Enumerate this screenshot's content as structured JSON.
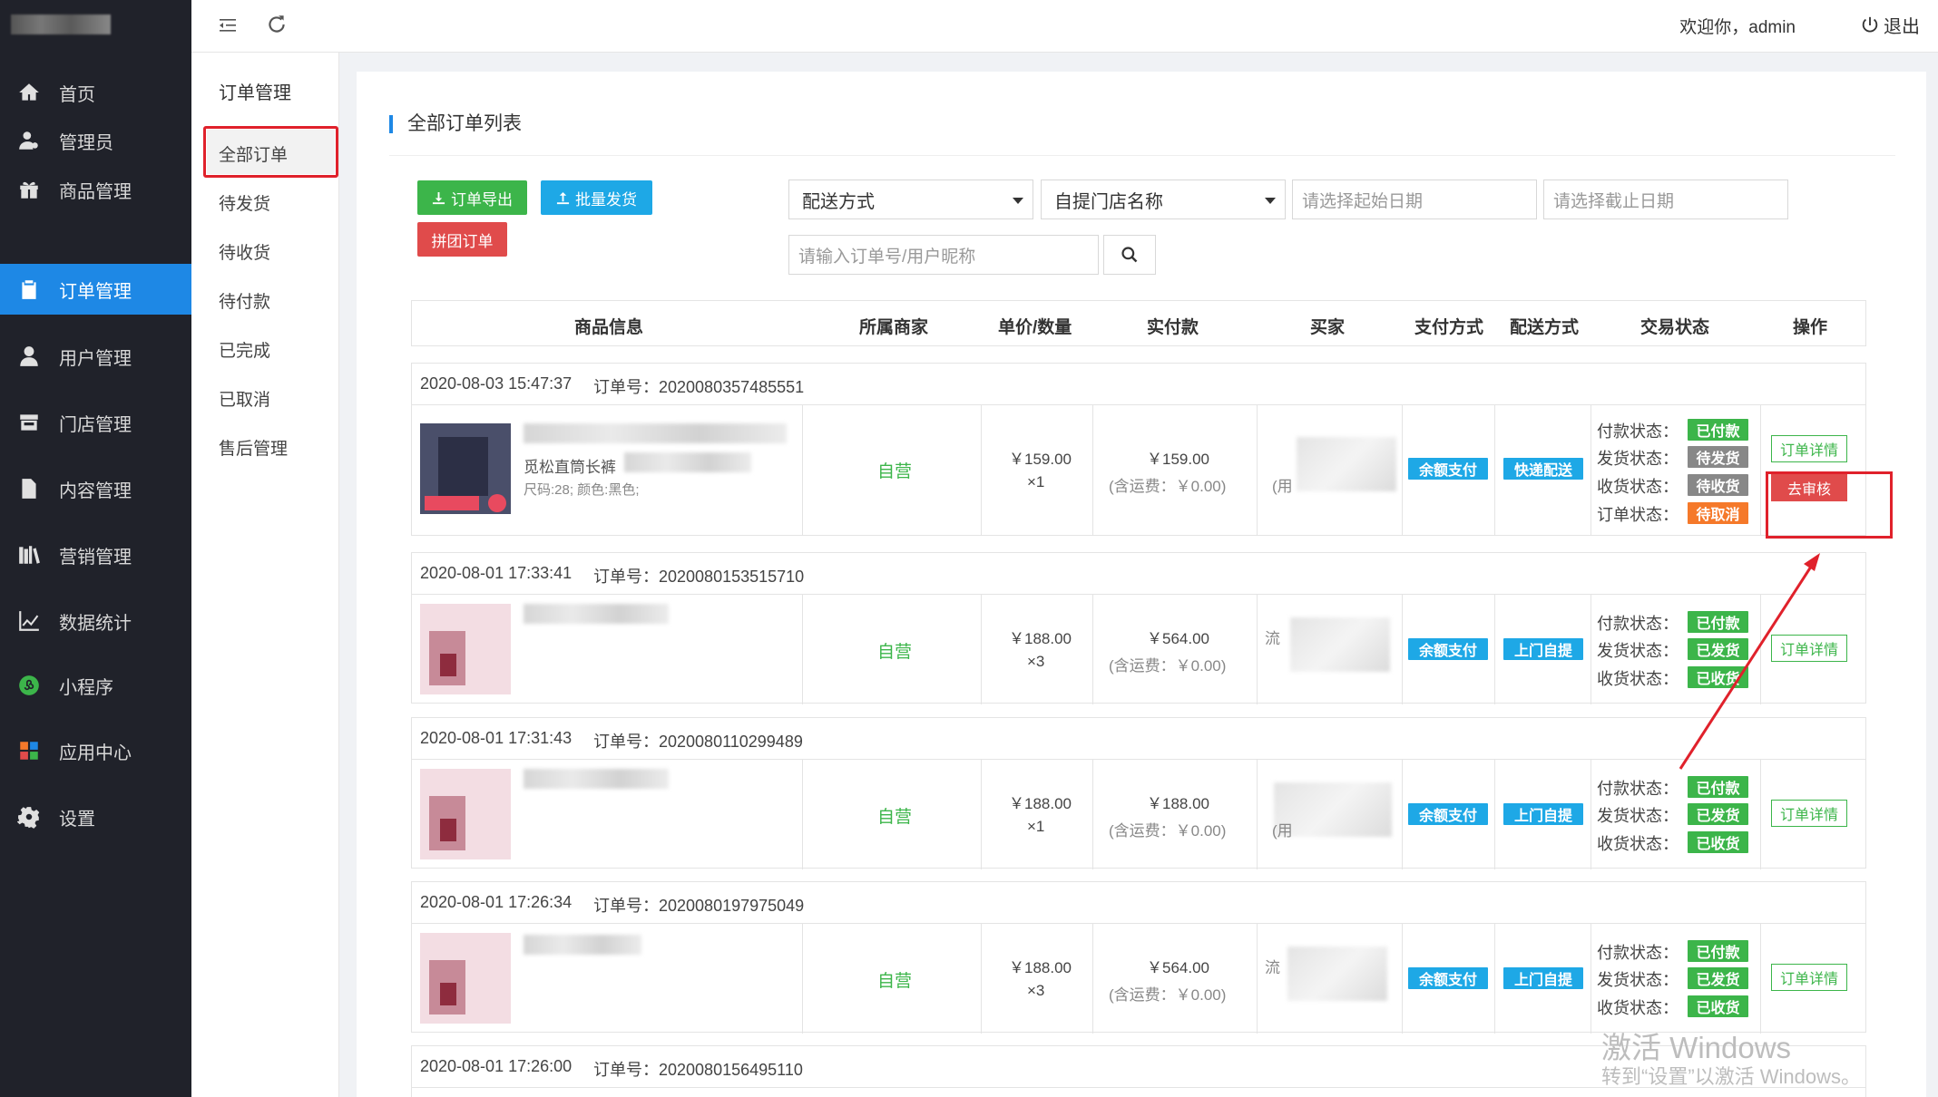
{
  "app": {
    "welcome": "欢迎你，admin",
    "logout": "退出"
  },
  "sidebar": {
    "items": [
      {
        "label": "首页",
        "icon": "home-icon"
      },
      {
        "label": "管理员",
        "icon": "admin-user-icon"
      },
      {
        "label": "商品管理",
        "icon": "gift-icon"
      },
      {
        "label": "订单管理",
        "icon": "clipboard-icon",
        "active": true
      },
      {
        "label": "用户管理",
        "icon": "user-icon"
      },
      {
        "label": "门店管理",
        "icon": "store-icon"
      },
      {
        "label": "内容管理",
        "icon": "document-icon"
      },
      {
        "label": "营销管理",
        "icon": "books-icon"
      },
      {
        "label": "数据统计",
        "icon": "line-chart-icon"
      },
      {
        "label": "小程序",
        "icon": "mini-program-icon"
      },
      {
        "label": "应用中心",
        "icon": "apps-icon"
      },
      {
        "label": "设置",
        "icon": "gear-icon"
      }
    ]
  },
  "subnav": {
    "title": "订单管理",
    "items": [
      "全部订单",
      "待发货",
      "待收货",
      "待付款",
      "已完成",
      "已取消",
      "售后管理"
    ]
  },
  "panel": {
    "title": "全部订单列表",
    "export_label": "订单导出",
    "batch_ship_label": "批量发货",
    "group_order_label": "拼团订单",
    "delivery_select": "配送方式",
    "store_select": "自提门店名称",
    "start_date_placeholder": "请选择起始日期",
    "end_date_placeholder": "请选择截止日期",
    "search_placeholder": "请输入订单号/用户昵称"
  },
  "table": {
    "headers": [
      "商品信息",
      "所属商家",
      "单价/数量",
      "实付款",
      "买家",
      "支付方式",
      "配送方式",
      "交易状态",
      "操作"
    ],
    "order_no_label": "订单号：",
    "orders": [
      {
        "time": "2020-08-03 15:47:37",
        "order_no": "2020080357485551",
        "goods_name": "觅松直筒长裤",
        "goods_spec": "尺码:28; 颜色:黑色;",
        "merchant": "自营",
        "price": "￥159.00",
        "qty": "×1",
        "paid": "￥159.00",
        "ship_fee": "(含运费：￥0.00)",
        "buyer": "(用",
        "pay_method": "余额支付",
        "delivery": "快递配送",
        "status": [
          {
            "label": "付款状态：",
            "value": "已付款",
            "color": "green"
          },
          {
            "label": "发货状态：",
            "value": "待发货",
            "color": "gray"
          },
          {
            "label": "收货状态：",
            "value": "待收货",
            "color": "gray"
          },
          {
            "label": "订单状态：",
            "value": "待取消",
            "color": "orange"
          }
        ],
        "detail_label": "订单详情",
        "audit_label": "去审核"
      },
      {
        "time": "2020-08-01 17:33:41",
        "order_no": "2020080153515710",
        "merchant": "自营",
        "price": "￥188.00",
        "qty": "×3",
        "paid": "￥564.00",
        "ship_fee": "(含运费：￥0.00)",
        "buyer": "流",
        "pay_method": "余额支付",
        "delivery": "上门自提",
        "status": [
          {
            "label": "付款状态：",
            "value": "已付款",
            "color": "green"
          },
          {
            "label": "发货状态：",
            "value": "已发货",
            "color": "green"
          },
          {
            "label": "收货状态：",
            "value": "已收货",
            "color": "green"
          }
        ],
        "detail_label": "订单详情"
      },
      {
        "time": "2020-08-01 17:31:43",
        "order_no": "2020080110299489",
        "merchant": "自营",
        "price": "￥188.00",
        "qty": "×1",
        "paid": "￥188.00",
        "ship_fee": "(含运费：￥0.00)",
        "buyer": "(用",
        "pay_method": "余额支付",
        "delivery": "上门自提",
        "status": [
          {
            "label": "付款状态：",
            "value": "已付款",
            "color": "green"
          },
          {
            "label": "发货状态：",
            "value": "已发货",
            "color": "green"
          },
          {
            "label": "收货状态：",
            "value": "已收货",
            "color": "green"
          }
        ],
        "detail_label": "订单详情"
      },
      {
        "time": "2020-08-01 17:26:34",
        "order_no": "2020080197975049",
        "merchant": "自营",
        "price": "￥188.00",
        "qty": "×3",
        "paid": "￥564.00",
        "ship_fee": "(含运费：￥0.00)",
        "buyer": "流",
        "pay_method": "余额支付",
        "delivery": "上门自提",
        "status": [
          {
            "label": "付款状态：",
            "value": "已付款",
            "color": "green"
          },
          {
            "label": "发货状态：",
            "value": "已发货",
            "color": "green"
          },
          {
            "label": "收货状态：",
            "value": "已收货",
            "color": "green"
          }
        ],
        "detail_label": "订单详情"
      },
      {
        "time": "2020-08-01 17:26:00",
        "order_no": "2020080156495110"
      }
    ]
  },
  "watermark": {
    "line1": "激活 Windows",
    "line2": "转到“设置”以激活 Windows。"
  },
  "colors": {
    "accent": "#1e88e5",
    "green": "#3cb54a",
    "red": "#e04b4b",
    "sidebar_bg": "#20222a"
  }
}
